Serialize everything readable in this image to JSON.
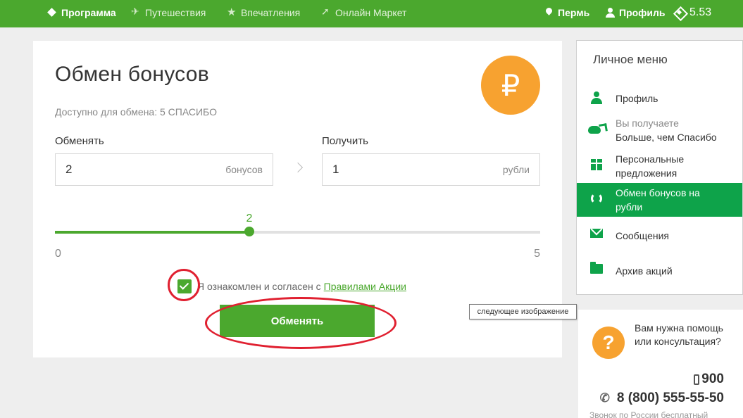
{
  "nav": {
    "items": [
      {
        "label": "Программа",
        "icon": "diamond-icon",
        "active": true
      },
      {
        "label": "Путешествия",
        "icon": "plane-icon",
        "active": false
      },
      {
        "label": "Впечатления",
        "icon": "star-icon",
        "active": false
      },
      {
        "label": "Онлайн Маркет",
        "icon": "cursor-icon",
        "active": false
      }
    ],
    "city": "Пермь",
    "profile": "Профиль",
    "balance": "5.53"
  },
  "exchange": {
    "title": "Обмен бонусов",
    "currency_symbol": "₽",
    "available": "Доступно для обмена: 5 СПАСИБО",
    "from_label": "Обменять",
    "from_value": "2",
    "from_unit": "бонусов",
    "to_label": "Получить",
    "to_value": "1",
    "to_unit": "рубли",
    "slider": {
      "min": "0",
      "max": "5",
      "value": "2",
      "fraction": 0.4
    },
    "agree_text": "Я ознакомлен и согласен с",
    "agree_link": "Правилами Акции",
    "agree_checked": true,
    "submit_label": "Обменять",
    "accent_color": "#4ba82e",
    "annotation_color": "#e02030"
  },
  "tooltip": "следующее изображение",
  "side_menu": {
    "title": "Личное меню",
    "items": [
      {
        "label": "Профиль",
        "icon": "user-icon"
      },
      {
        "sub": "Вы получаете",
        "label": "Больше, чем Спасибо",
        "icon": "whale-icon"
      },
      {
        "label": "Персональные",
        "label2": "предложения",
        "icon": "gift-icon"
      },
      {
        "label": "Обмен бонусов на",
        "label2": "рубли",
        "icon": "refresh-icon",
        "active": true
      },
      {
        "label": "Сообщения",
        "icon": "mail-icon"
      },
      {
        "label": "Архив акций",
        "icon": "folder-icon"
      }
    ]
  },
  "help": {
    "badge": "?",
    "text": "Вам нужна помощь или консультация?",
    "short_phone": "900",
    "long_phone": "8 (800) 555-55-50",
    "note": "Звонок по России бесплатный"
  }
}
